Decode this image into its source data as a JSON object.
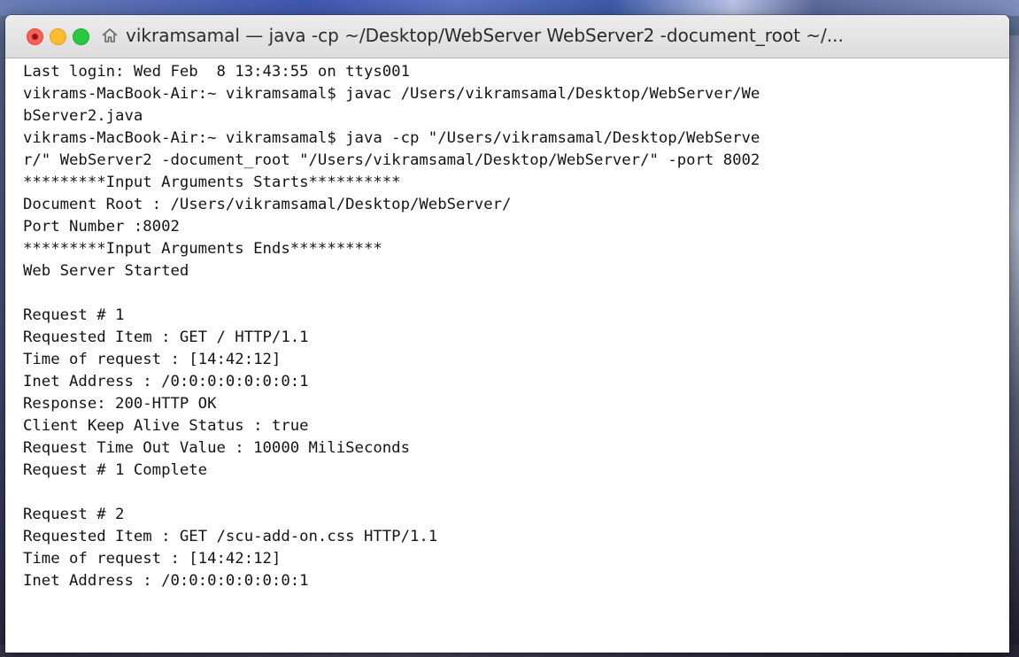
{
  "window": {
    "title": "vikramsamal — java -cp ~/Desktop/WebServer WebServer2 -document_root ~/..."
  },
  "icons": {
    "close": "close-button",
    "minimize": "minimize-button",
    "maximize": "zoom-button",
    "home": "home-icon"
  },
  "colors": {
    "close": "#fc5f57",
    "minimize": "#fdbc2e",
    "maximize": "#29c840"
  },
  "terminal": {
    "lines": [
      "Last login: Wed Feb  8 13:43:55 on ttys001",
      "vikrams-MacBook-Air:~ vikramsamal$ javac /Users/vikramsamal/Desktop/WebServer/We",
      "bServer2.java",
      "vikrams-MacBook-Air:~ vikramsamal$ java -cp \"/Users/vikramsamal/Desktop/WebServe",
      "r/\" WebServer2 -document_root \"/Users/vikramsamal/Desktop/WebServer/\" -port 8002",
      "*********Input Arguments Starts**********",
      "Document Root : /Users/vikramsamal/Desktop/WebServer/",
      "Port Number :8002",
      "*********Input Arguments Ends**********",
      "Web Server Started",
      "",
      "Request # 1",
      "Requested Item : GET / HTTP/1.1",
      "Time of request : [14:42:12]",
      "Inet Address : /0:0:0:0:0:0:0:1",
      "Response: 200-HTTP OK",
      "Client Keep Alive Status : true",
      "Request Time Out Value : 10000 MiliSeconds",
      "Request # 1 Complete",
      "",
      "Request # 2",
      "Requested Item : GET /scu-add-on.css HTTP/1.1",
      "Time of request : [14:42:12]",
      "Inet Address : /0:0:0:0:0:0:0:1"
    ]
  }
}
